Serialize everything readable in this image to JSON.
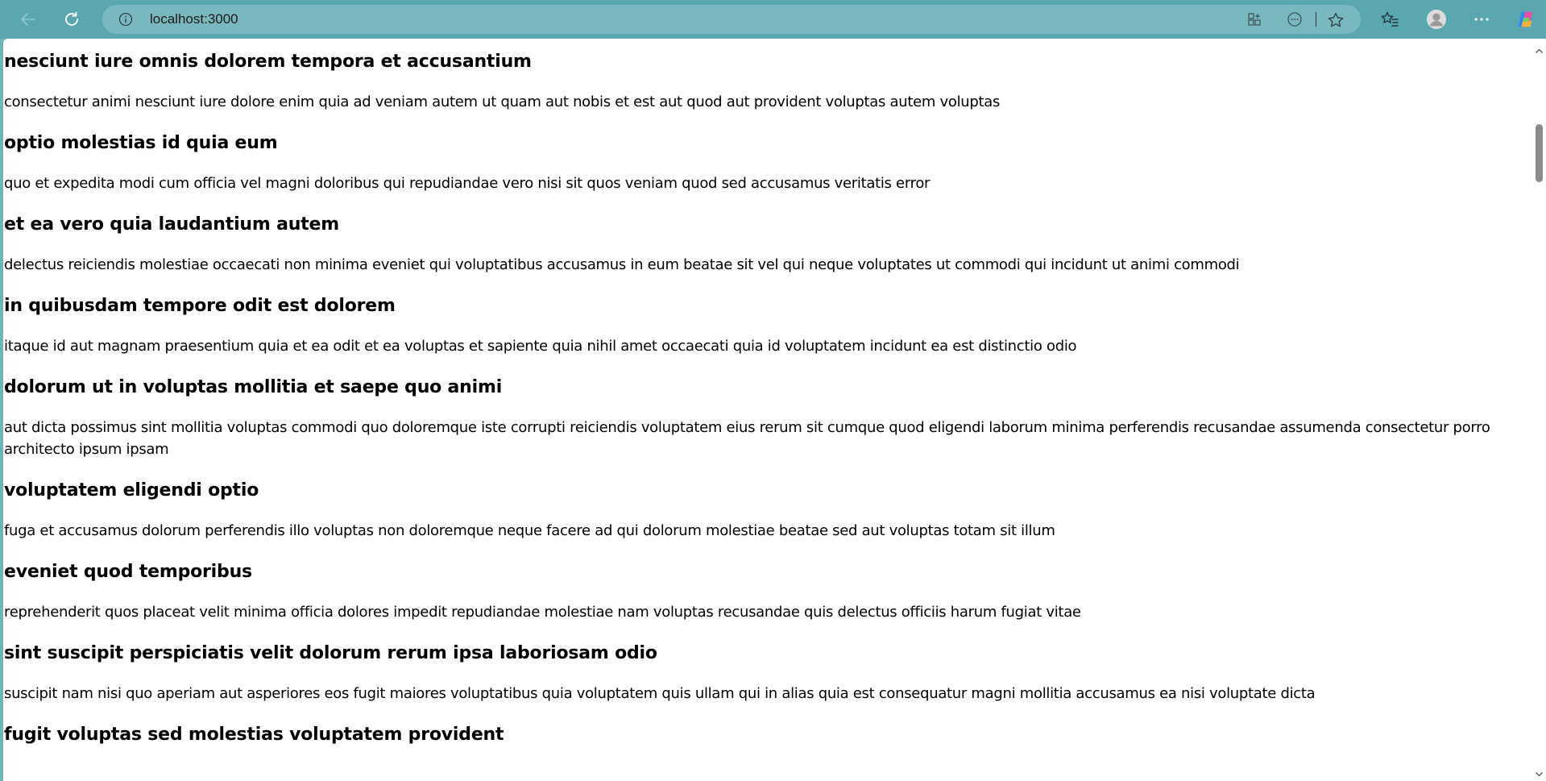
{
  "browser": {
    "url": "localhost:3000",
    "icons": [
      "back-icon",
      "refresh-icon",
      "site-info-icon",
      "app-available-icon",
      "copilot-read-icon",
      "favorite-star-icon",
      "favorites-icon",
      "profile-icon",
      "more-icon",
      "copilot-icon"
    ]
  },
  "posts": [
    {
      "title": "nesciunt iure omnis dolorem tempora et accusantium",
      "body": "consectetur animi nesciunt iure dolore enim quia ad veniam autem ut quam aut nobis et est aut quod aut provident voluptas autem voluptas"
    },
    {
      "title": "optio molestias id quia eum",
      "body": "quo et expedita modi cum officia vel magni doloribus qui repudiandae vero nisi sit quos veniam quod sed accusamus veritatis error"
    },
    {
      "title": "et ea vero quia laudantium autem",
      "body": "delectus reiciendis molestiae occaecati non minima eveniet qui voluptatibus accusamus in eum beatae sit vel qui neque voluptates ut commodi qui incidunt ut animi commodi"
    },
    {
      "title": "in quibusdam tempore odit est dolorem",
      "body": "itaque id aut magnam praesentium quia et ea odit et ea voluptas et sapiente quia nihil amet occaecati quia id voluptatem incidunt ea est distinctio odio"
    },
    {
      "title": "dolorum ut in voluptas mollitia et saepe quo animi",
      "body": "aut dicta possimus sint mollitia voluptas commodi quo doloremque iste corrupti reiciendis voluptatem eius rerum sit cumque quod eligendi laborum minima perferendis recusandae assumenda consectetur porro architecto ipsum ipsam"
    },
    {
      "title": "voluptatem eligendi optio",
      "body": "fuga et accusamus dolorum perferendis illo voluptas non doloremque neque facere ad qui dolorum molestiae beatae sed aut voluptas totam sit illum"
    },
    {
      "title": "eveniet quod temporibus",
      "body": "reprehenderit quos placeat velit minima officia dolores impedit repudiandae molestiae nam voluptas recusandae quis delectus officiis harum fugiat vitae"
    },
    {
      "title": "sint suscipit perspiciatis velit dolorum rerum ipsa laboriosam odio",
      "body": "suscipit nam nisi quo aperiam aut asperiores eos fugit maiores voluptatibus quia voluptatem quis ullam qui in alias quia est consequatur magni mollitia accusamus ea nisi voluptate dicta"
    },
    {
      "title": "fugit voluptas sed molestias voluptatem provident",
      "body": ""
    }
  ]
}
